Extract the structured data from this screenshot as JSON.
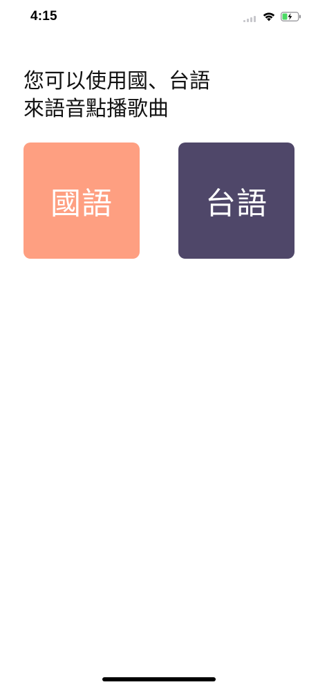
{
  "status_bar": {
    "time": "4:15",
    "icons": [
      "cellular-signal-icon",
      "wifi-icon",
      "battery-charging-icon"
    ]
  },
  "heading": {
    "line1": "您可以使用國、台語",
    "line2": "來語音點播歌曲"
  },
  "buttons": {
    "mandarin": {
      "label": "國語",
      "color": "#FE9F81"
    },
    "taiwanese": {
      "label": "台語",
      "color": "#4F4769"
    }
  },
  "colors": {
    "background": "#FFFFFF",
    "battery_fill": "#4CD964",
    "signal_inactive": "#C7C7CC"
  }
}
